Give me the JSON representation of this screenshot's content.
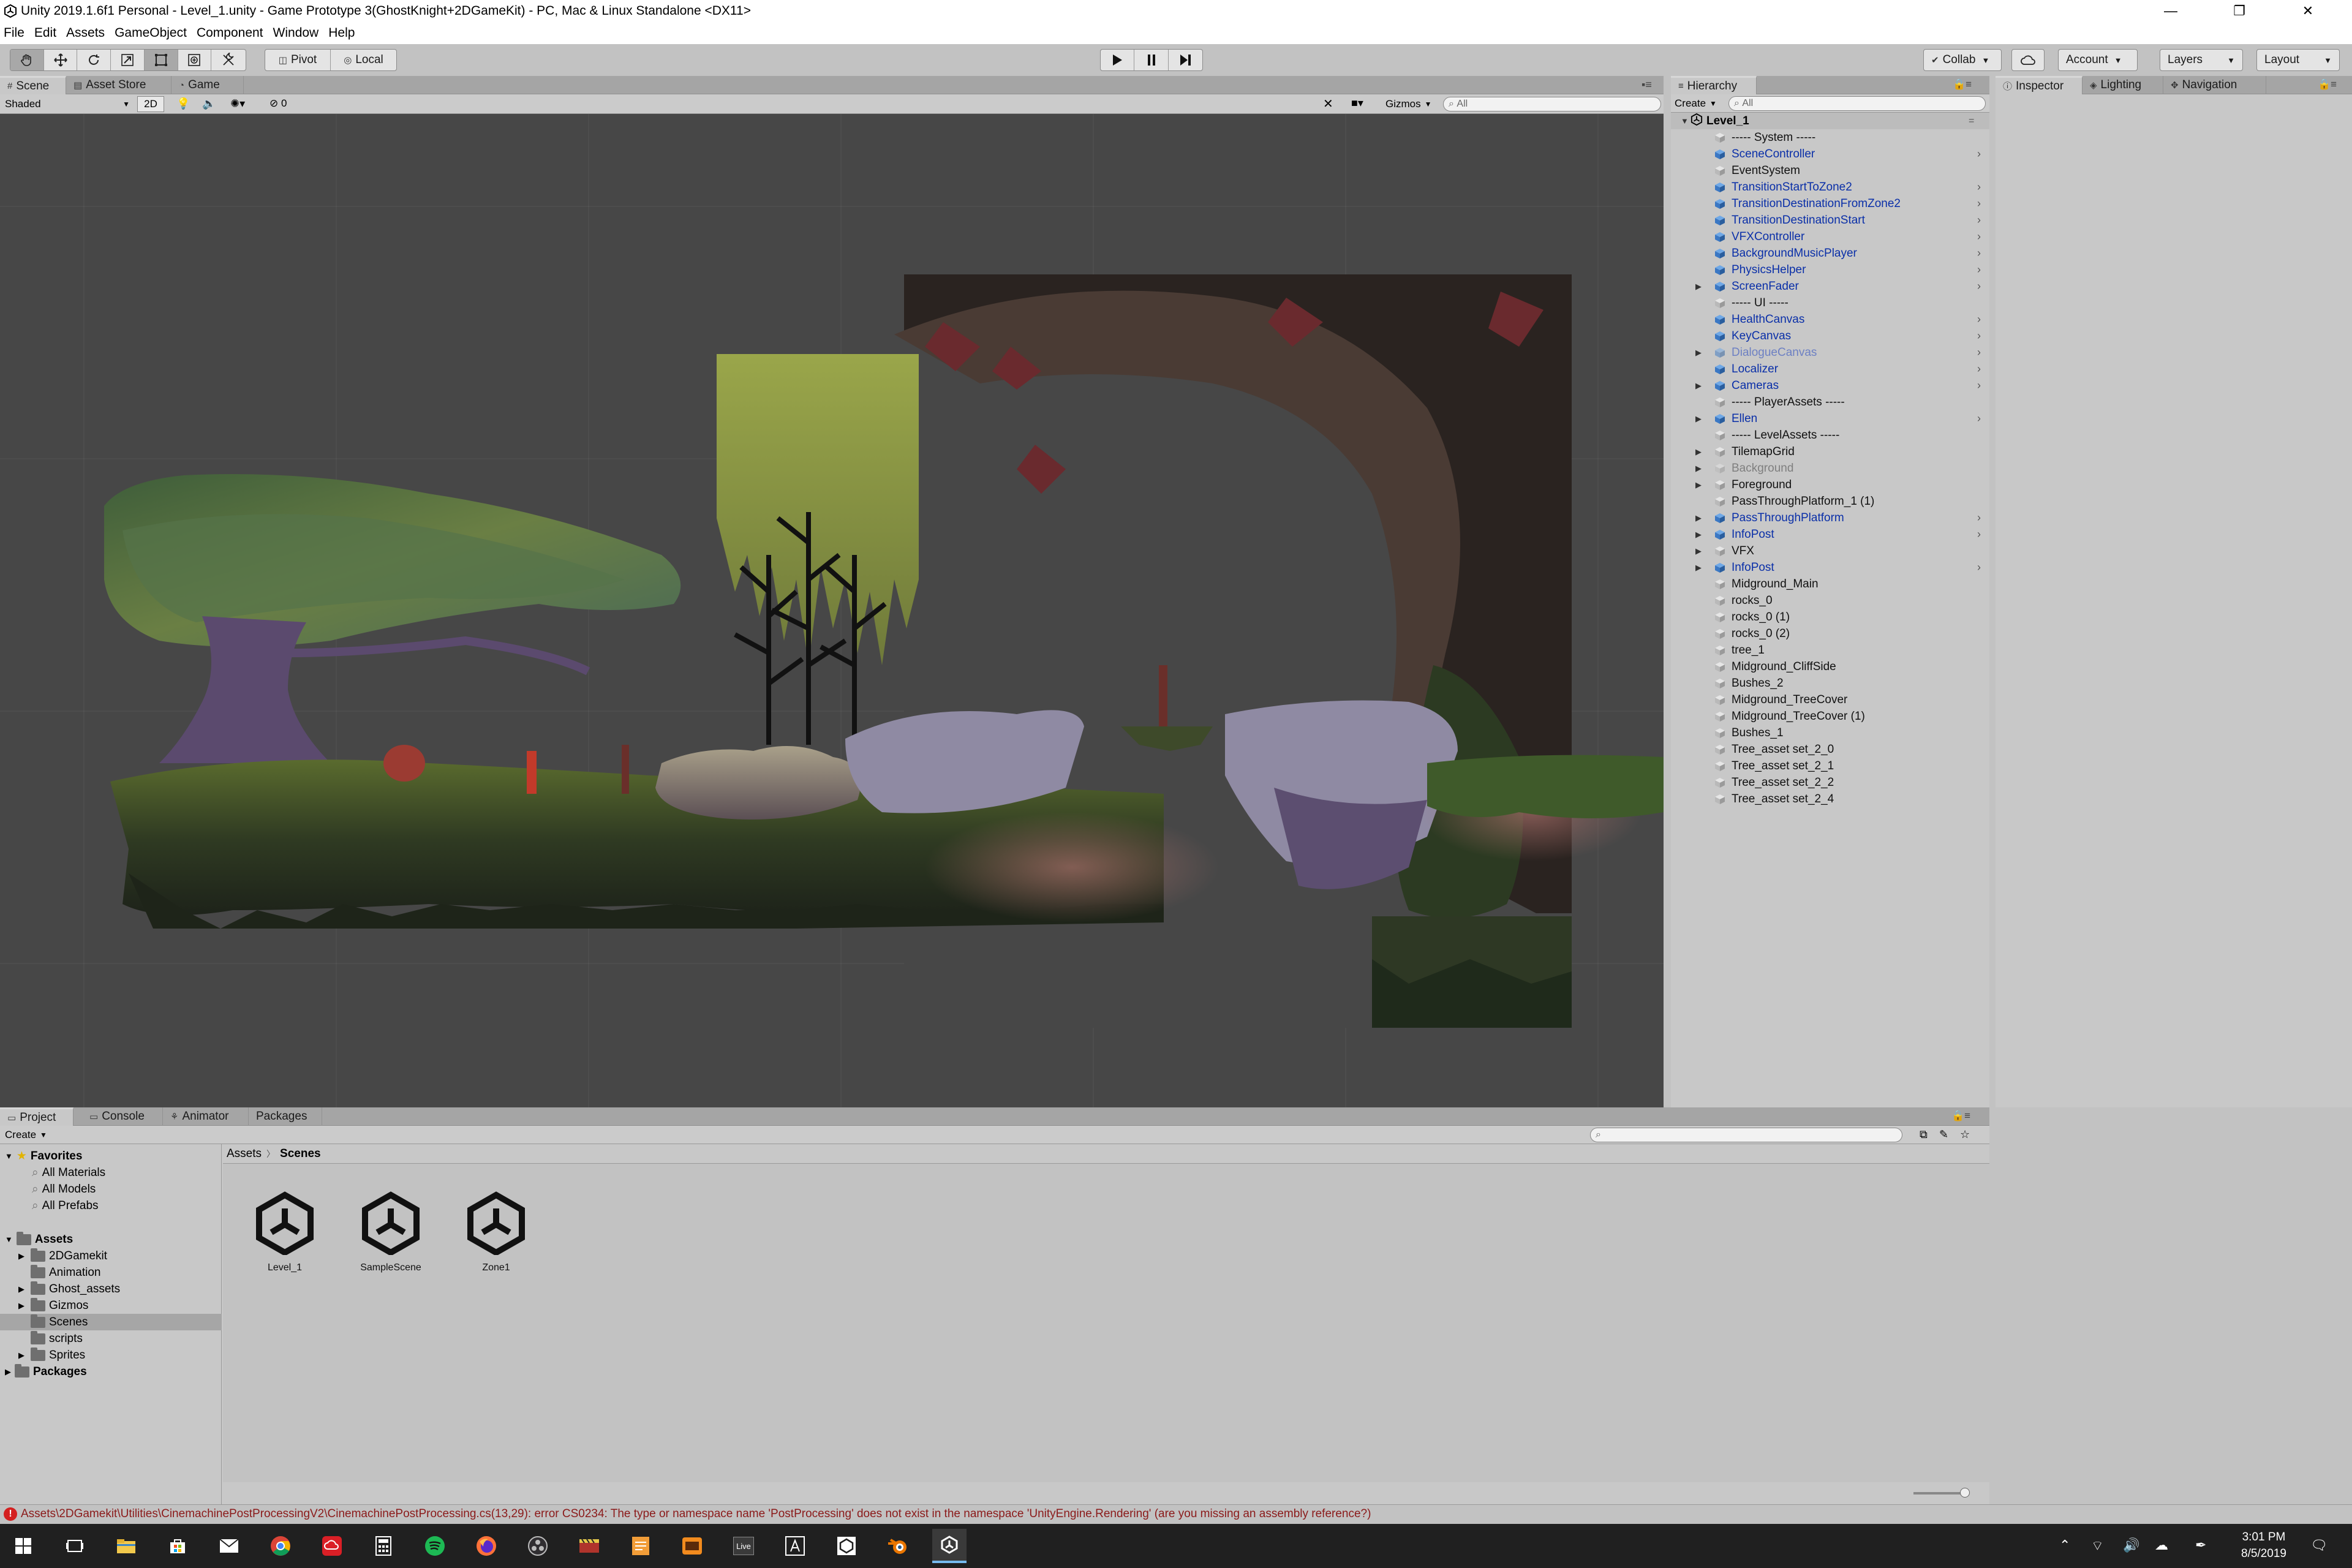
{
  "window": {
    "title": "Unity 2019.1.6f1 Personal - Level_1.unity - Game Prototype 3(GhostKnight+2DGameKit) - PC, Mac & Linux Standalone <DX11>",
    "minimize": "—",
    "restore": "❐",
    "close": "✕"
  },
  "menu": [
    "File",
    "Edit",
    "Assets",
    "GameObject",
    "Component",
    "Window",
    "Help"
  ],
  "toolbar": {
    "pivot": "Pivot",
    "local": "Local",
    "collab": "Collab",
    "account": "Account",
    "layers": "Layers",
    "layout": "Layout"
  },
  "scene_tabs": [
    "Scene",
    "Asset Store",
    "Game"
  ],
  "scene_toolbar": {
    "shading": "Shaded",
    "mode_2d": "2D",
    "hidden_count": "0",
    "gizmos": "Gizmos",
    "search_placeholder": "All"
  },
  "hierarchy": {
    "tab": "Hierarchy",
    "create": "Create",
    "search_placeholder": "All",
    "scene_name": "Level_1",
    "items": [
      {
        "label": "----- System -----",
        "type": "normal",
        "arrow": false,
        "chev": false
      },
      {
        "label": "SceneController",
        "type": "prefab",
        "arrow": false,
        "chev": true
      },
      {
        "label": "EventSystem",
        "type": "normal",
        "arrow": false,
        "chev": false
      },
      {
        "label": "TransitionStartToZone2",
        "type": "prefab",
        "arrow": false,
        "chev": true
      },
      {
        "label": "TransitionDestinationFromZone2",
        "type": "prefab",
        "arrow": false,
        "chev": true
      },
      {
        "label": "TransitionDestinationStart",
        "type": "prefab",
        "arrow": false,
        "chev": true
      },
      {
        "label": "VFXController",
        "type": "prefab",
        "arrow": false,
        "chev": true
      },
      {
        "label": "BackgroundMusicPlayer",
        "type": "prefab",
        "arrow": false,
        "chev": true
      },
      {
        "label": "PhysicsHelper",
        "type": "prefab",
        "arrow": false,
        "chev": true
      },
      {
        "label": "ScreenFader",
        "type": "prefab",
        "arrow": true,
        "chev": true
      },
      {
        "label": "----- UI -----",
        "type": "normal",
        "arrow": false,
        "chev": false
      },
      {
        "label": "HealthCanvas",
        "type": "prefab",
        "arrow": false,
        "chev": true
      },
      {
        "label": "KeyCanvas",
        "type": "prefab",
        "arrow": false,
        "chev": true
      },
      {
        "label": "DialogueCanvas",
        "type": "prefab-disabled",
        "arrow": true,
        "chev": true
      },
      {
        "label": "Localizer",
        "type": "prefab",
        "arrow": false,
        "chev": true
      },
      {
        "label": "Cameras",
        "type": "prefab",
        "arrow": true,
        "chev": true
      },
      {
        "label": "----- PlayerAssets -----",
        "type": "normal",
        "arrow": false,
        "chev": false
      },
      {
        "label": "Ellen",
        "type": "prefab",
        "arrow": true,
        "chev": true
      },
      {
        "label": "----- LevelAssets -----",
        "type": "normal",
        "arrow": false,
        "chev": false
      },
      {
        "label": "TilemapGrid",
        "type": "normal",
        "arrow": true,
        "chev": false
      },
      {
        "label": "Background",
        "type": "disabled",
        "arrow": true,
        "chev": false
      },
      {
        "label": "Foreground",
        "type": "normal",
        "arrow": true,
        "chev": false
      },
      {
        "label": "PassThroughPlatform_1 (1)",
        "type": "normal",
        "arrow": false,
        "chev": false
      },
      {
        "label": "PassThroughPlatform",
        "type": "prefab",
        "arrow": true,
        "chev": true
      },
      {
        "label": "InfoPost",
        "type": "prefab",
        "arrow": true,
        "chev": true
      },
      {
        "label": "VFX",
        "type": "normal",
        "arrow": true,
        "chev": false
      },
      {
        "label": "InfoPost",
        "type": "prefab",
        "arrow": true,
        "chev": true
      },
      {
        "label": "Midground_Main",
        "type": "normal",
        "arrow": false,
        "chev": false
      },
      {
        "label": "rocks_0",
        "type": "normal",
        "arrow": false,
        "chev": false
      },
      {
        "label": "rocks_0 (1)",
        "type": "normal",
        "arrow": false,
        "chev": false
      },
      {
        "label": "rocks_0 (2)",
        "type": "normal",
        "arrow": false,
        "chev": false
      },
      {
        "label": "tree_1",
        "type": "normal",
        "arrow": false,
        "chev": false
      },
      {
        "label": "Midground_CliffSide",
        "type": "normal",
        "arrow": false,
        "chev": false
      },
      {
        "label": "Bushes_2",
        "type": "normal",
        "arrow": false,
        "chev": false
      },
      {
        "label": "Midground_TreeCover",
        "type": "normal",
        "arrow": false,
        "chev": false
      },
      {
        "label": "Midground_TreeCover (1)",
        "type": "normal",
        "arrow": false,
        "chev": false
      },
      {
        "label": "Bushes_1",
        "type": "normal",
        "arrow": false,
        "chev": false
      },
      {
        "label": "Tree_asset set_2_0",
        "type": "normal",
        "arrow": false,
        "chev": false
      },
      {
        "label": "Tree_asset set_2_1",
        "type": "normal",
        "arrow": false,
        "chev": false
      },
      {
        "label": "Tree_asset set_2_2",
        "type": "normal",
        "arrow": false,
        "chev": false
      },
      {
        "label": "Tree_asset set_2_4",
        "type": "normal",
        "arrow": false,
        "chev": false
      }
    ]
  },
  "inspector_tabs": [
    "Inspector",
    "Lighting",
    "Navigation"
  ],
  "bottom_tabs": [
    "Project",
    "Console",
    "Animator",
    "Packages"
  ],
  "project": {
    "create": "Create",
    "favorites_label": "Favorites",
    "favorites": [
      "All Materials",
      "All Models",
      "All Prefabs"
    ],
    "assets_label": "Assets",
    "folders": [
      {
        "name": "2DGamekit",
        "arrow": true,
        "selected": false
      },
      {
        "name": "Animation",
        "arrow": false,
        "selected": false
      },
      {
        "name": "Ghost_assets",
        "arrow": true,
        "selected": false
      },
      {
        "name": "Gizmos",
        "arrow": true,
        "selected": false
      },
      {
        "name": "Scenes",
        "arrow": false,
        "selected": true
      },
      {
        "name": "scripts",
        "arrow": false,
        "selected": false
      },
      {
        "name": "Sprites",
        "arrow": true,
        "selected": false
      }
    ],
    "packages_label": "Packages",
    "breadcrumb_root": "Assets",
    "breadcrumb_current": "Scenes",
    "scene_assets": [
      "Level_1",
      "SampleScene",
      "Zone1"
    ]
  },
  "status": {
    "error": "Assets\\2DGamekit\\Utilities\\CinemachinePostProcessingV2\\CinemachinePostProcessing.cs(13,29): error CS0234: The type or namespace name 'PostProcessing' does not exist in the namespace 'UnityEngine.Rendering' (are you missing an assembly reference?)"
  },
  "taskbar": {
    "time": "3:01 PM",
    "date": "8/5/2019",
    "live_label": "Live"
  },
  "colors": {
    "scene_bg": "#474747",
    "panel_bg": "#c8c8c8",
    "prefab_blue": "#0a2fa8",
    "error_red": "#8b1a1a",
    "taskbar": "#202020"
  }
}
